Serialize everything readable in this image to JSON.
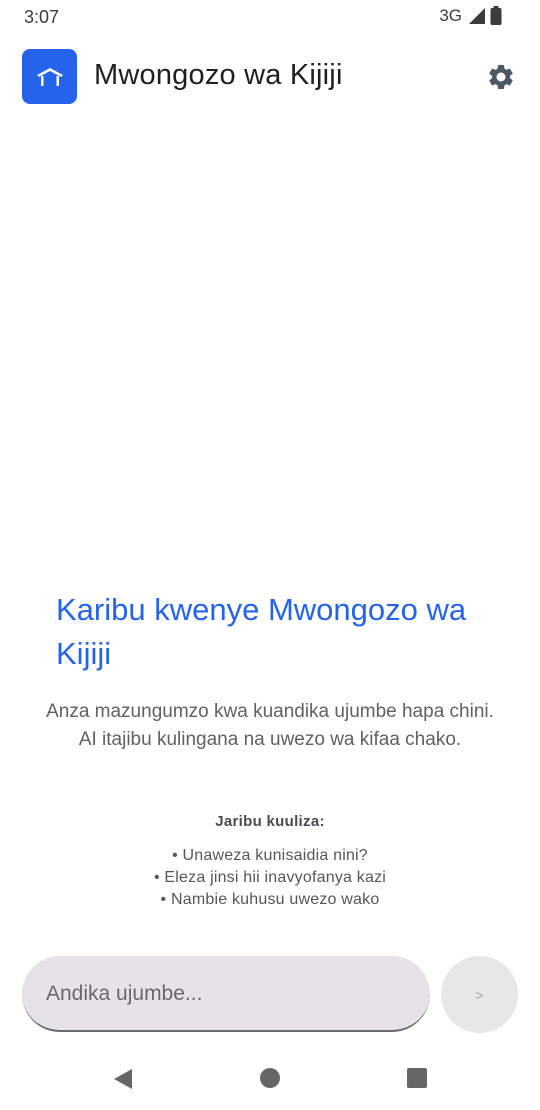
{
  "status_bar": {
    "time": "3:07",
    "network": "3G"
  },
  "app_bar": {
    "title": "Mwongozo wa Kijiji",
    "logo_icon": "village-home-icon",
    "settings_icon": "gear-icon"
  },
  "welcome": {
    "title": "Karibu kwenye Mwongozo wa Kijiji",
    "description": "Anza mazungumzo kwa kuandika ujumbe hapa chini. AI itajibu kulingana na uwezo wa kifaa chako.",
    "suggestions_heading": "Jaribu kuuliza:",
    "suggestions": [
      "• Unaweza kunisaidia nini?",
      "• Eleza jinsi hii inavyofanya kazi",
      "• Nambie kuhusu uwezo wako"
    ]
  },
  "composer": {
    "placeholder": "Andika ujumbe...",
    "send_symbol": ">"
  },
  "colors": {
    "accent": "#2563eb",
    "input_bg": "#e7e1e8"
  }
}
